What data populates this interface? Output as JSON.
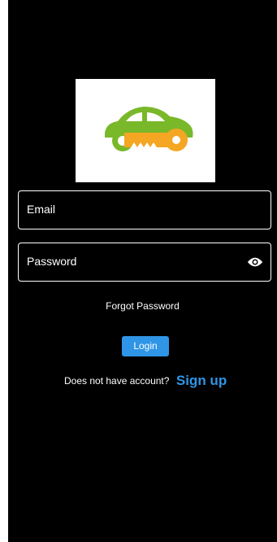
{
  "app": {
    "background": "#000000",
    "accent": "#2f95e6"
  },
  "logo": {
    "icon": "car-key-logo",
    "car_color": "#79b829",
    "key_color": "#f5a623"
  },
  "form": {
    "email_placeholder": "Email",
    "password_placeholder": "Password",
    "visibility_icon": "eye-icon"
  },
  "links": {
    "forgot_password": "Forgot Password",
    "no_account_prompt": "Does not have account?",
    "sign_up": "Sign up"
  },
  "buttons": {
    "login": "Login"
  }
}
